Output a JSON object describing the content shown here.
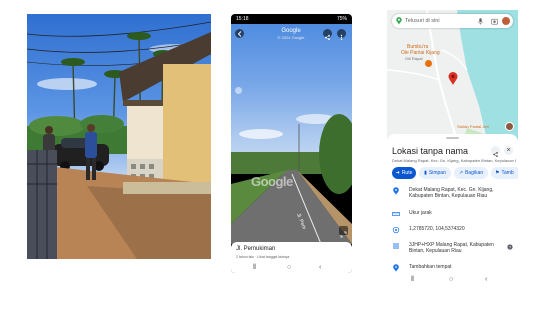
{
  "streetview": {
    "status_time": "15:18",
    "status_battery": "75%",
    "title": "Google",
    "subtitle": "© 2024 Google",
    "road_label": "Jl. Pemukiman",
    "road_meta": "2 tahun lalu · Lihat tanggal lainnya",
    "watermark": "Google"
  },
  "maps": {
    "search_placeholder": "Telusuri di sini",
    "map_labels": {
      "poi_name": "Bumbu'ra",
      "poi_sub": "Ole Pantai Kijang",
      "poi_sub2": "Gili Rapat",
      "south_place": "Sisilan Pantai Jeri"
    },
    "place_title": "Lokasi tanpa nama",
    "place_address_short": "Dekat Malang Rapat, Kec. Gn. Kijang, Kabupaten Bintan, Kepulauan Riau",
    "actions": [
      "Rute",
      "Simpan",
      "Bagikan",
      "Tamb"
    ],
    "details": [
      {
        "icon": "location-pin-icon",
        "text": "Dekat Malang Rapat, Kec. Gn. Kijang, Kabupaten Bintan, Kepulauan Riau"
      },
      {
        "icon": "ruler-icon",
        "text": "Ukur jarak"
      },
      {
        "icon": "target-icon",
        "text": "1,2785720, 104,5374320"
      },
      {
        "icon": "grid-icon",
        "text": "3JHP+HXP Malang Rapat, Kabupaten Bintan, Kepulauan Riau"
      },
      {
        "icon": "add-place-icon",
        "text": "Tambahkan tempat"
      }
    ]
  },
  "colors": {
    "accent_blue": "#1a73e8",
    "chip_blue": "#0b57d0",
    "pin_red": "#d93025",
    "sea": "#9fe0e3"
  }
}
